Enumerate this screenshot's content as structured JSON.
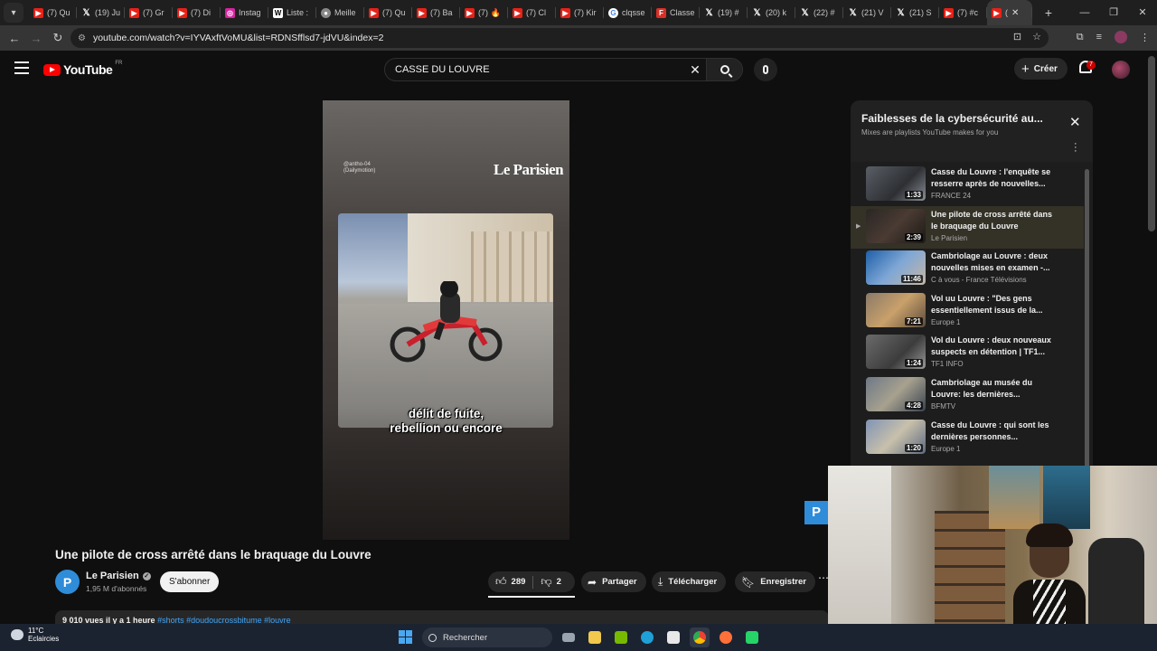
{
  "browser": {
    "tab_list_icon": "chevron-down-icon",
    "tabs": [
      {
        "label": "(7) Qu",
        "icon": "youtube"
      },
      {
        "label": "(19) Ju",
        "icon": "x"
      },
      {
        "label": "(7) Gr",
        "icon": "youtube"
      },
      {
        "label": "(7) Di",
        "icon": "youtube"
      },
      {
        "label": "Instag",
        "icon": "instagram"
      },
      {
        "label": "Liste :",
        "icon": "wikipedia"
      },
      {
        "label": "Meille",
        "icon": "generic"
      },
      {
        "label": "(7) Qu",
        "icon": "youtube"
      },
      {
        "label": "(7) Ba",
        "icon": "youtube"
      },
      {
        "label": "(7) 🔥",
        "icon": "youtube"
      },
      {
        "label": "(7) Cl",
        "icon": "youtube"
      },
      {
        "label": "(7) Kir",
        "icon": "youtube"
      },
      {
        "label": "clqsse",
        "icon": "google"
      },
      {
        "label": "Classe",
        "icon": "f"
      },
      {
        "label": "(19) #",
        "icon": "x"
      },
      {
        "label": "(20) k",
        "icon": "x"
      },
      {
        "label": "(22) #",
        "icon": "x"
      },
      {
        "label": "(21) V",
        "icon": "x"
      },
      {
        "label": "(21) S",
        "icon": "x"
      },
      {
        "label": "(7) #c",
        "icon": "youtube"
      },
      {
        "label": "(",
        "icon": "youtube",
        "active": true
      }
    ],
    "url": "youtube.com/watch?v=IYVAxftVoMU&list=RDNSfflsd7-jdVU&index=2"
  },
  "youtube": {
    "region": "FR",
    "logo_text": "YouTube",
    "search": {
      "value": "CASSE DU LOUVRE"
    },
    "create_label": "Créer",
    "notification_count": "7"
  },
  "video": {
    "overlay_credit_line1": "@antho-04",
    "overlay_credit_line2": "(Dailymotion)",
    "overlay_brand": "Le Parisien",
    "caption_line1": "délit de fuite,",
    "caption_line2": "rebellion ou encore",
    "title": "Une pilote de cross arrêté dans le braquage du Louvre",
    "channel": {
      "avatar_letter": "P",
      "name": "Le Parisien",
      "subscribers": "1,95 M d'abonnés",
      "verified_glyph": "✓"
    },
    "subscribe_label": "S'abonner",
    "likes": "289",
    "dislikes": "2",
    "share_label": "Partager",
    "download_label": "Télécharger",
    "save_label": "Enregistrer",
    "views_line": "9 010 vues  il y a 1 heure",
    "hashtags": "#shorts #doudoucrossbitume #louvre"
  },
  "playlist": {
    "title": "Faiblesses de la cybersécurité au...",
    "subtitle": "Mixes are playlists YouTube makes for you",
    "items": [
      {
        "title": "Casse du Louvre : l'enquête se resserre après de nouvelles...",
        "channel": "FRANCE 24",
        "duration": "1:33",
        "thumb": "linear-gradient(135deg,#5a5f66,#2d2f33 60%,#8a8f96)"
      },
      {
        "title": "Une pilote de cross arrêté dans le braquage du Louvre",
        "channel": "Le Parisien",
        "duration": "2:39",
        "current": true,
        "thumb": "linear-gradient(135deg,#2a2624,#4a3b33 50%,#1b1816)"
      },
      {
        "title": "Cambriolage au Louvre : deux nouvelles mises en examen -...",
        "channel": "C à vous - France Télévisions",
        "duration": "11:46",
        "thumb": "linear-gradient(135deg,#1e5fa8,#7fa7d6 50%,#c7b7a4)"
      },
      {
        "title": "Vol uu Louvre : \"Des gens essentiellement issus de la...",
        "channel": "Europe 1",
        "duration": "7:21",
        "thumb": "linear-gradient(135deg,#8a7a6a,#c9a06a 50%,#5a4b3c)"
      },
      {
        "title": "Vol du Louvre : deux nouveaux suspects en détention | TF1...",
        "channel": "TF1 INFO",
        "duration": "1:24",
        "thumb": "linear-gradient(135deg,#6b6b6b,#3c3c3c 60%,#999)"
      },
      {
        "title": "Cambriolage au musée du Louvre: les dernières...",
        "channel": "BFMTV",
        "duration": "4:28",
        "thumb": "linear-gradient(135deg,#6d7886,#a7a18f 50%,#394250)"
      },
      {
        "title": "Casse du Louvre : qui sont les dernières personnes...",
        "channel": "Europe 1",
        "duration": "1:20",
        "thumb": "linear-gradient(135deg,#7f93b5,#c8c0ab 50%,#5d6a80)"
      }
    ]
  },
  "taskbar": {
    "temperature": "11°C",
    "weather": "Eclaircies",
    "search_placeholder": "Rechercher"
  },
  "colors": {
    "background": "#0f0f0f",
    "youtube_red": "#ff0000",
    "link_blue": "#3ea6ff"
  }
}
